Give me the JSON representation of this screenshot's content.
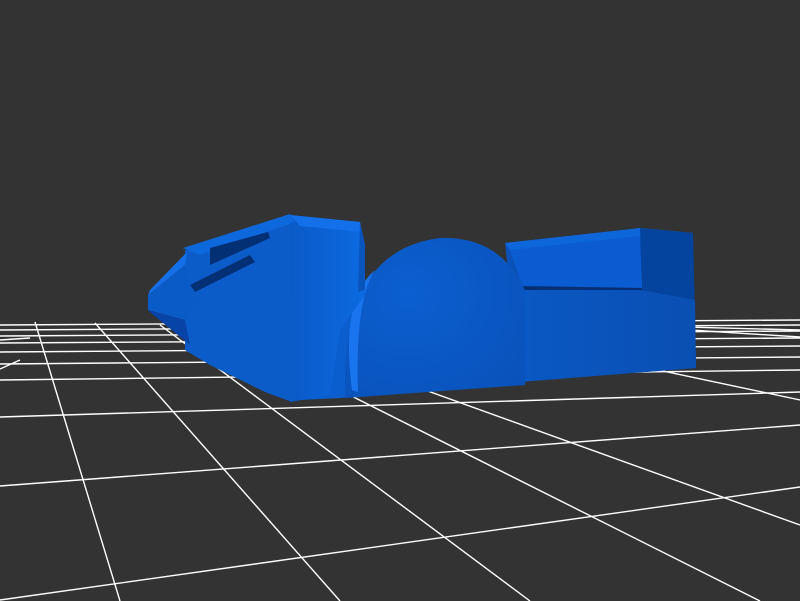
{
  "scene": {
    "background_color": "#333333",
    "grid_color": "#ffffff",
    "model_color": "#0a5fd0",
    "model_highlight_color": "#1a74ee",
    "model_shadow_color": "#04409a",
    "model_dark_color": "#032f74",
    "objects": [
      {
        "name": "floor-grid",
        "kind": "grid"
      },
      {
        "name": "3d-model",
        "kind": "mesh"
      }
    ]
  }
}
